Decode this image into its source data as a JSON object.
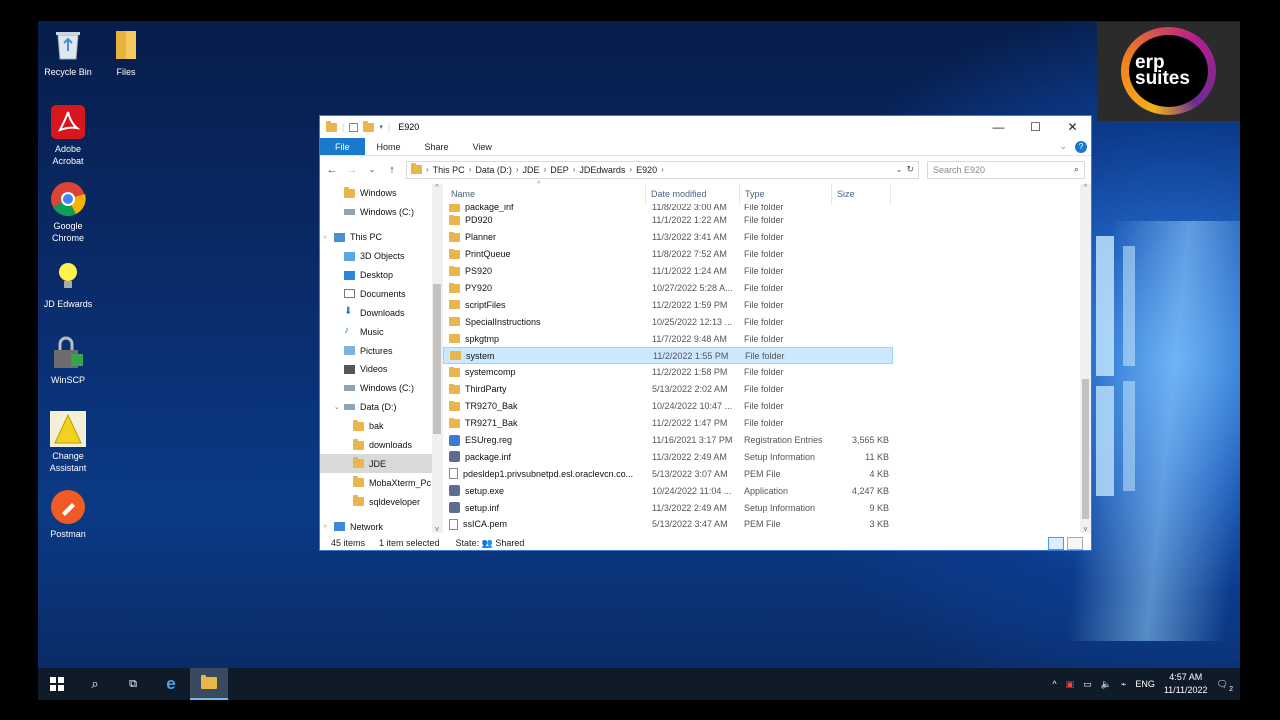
{
  "desktop_icons": [
    {
      "label": "Recycle Bin",
      "icon": "recycle-bin-icon"
    },
    {
      "label": "Files",
      "icon": "folder-icon"
    },
    {
      "label": "Adobe Acrobat",
      "icon": "acrobat-icon"
    },
    {
      "label": "Google Chrome",
      "icon": "chrome-icon"
    },
    {
      "label": "JD Edwards",
      "icon": "lightbulb-icon"
    },
    {
      "label": "WinSCP",
      "icon": "winscp-icon"
    },
    {
      "label": "Change Assistant",
      "icon": "change-assistant-icon"
    },
    {
      "label": "Postman",
      "icon": "postman-icon"
    }
  ],
  "brand": {
    "line1": "erp",
    "line2": "suites"
  },
  "window": {
    "title": "E920",
    "ribbon_tabs": [
      "File",
      "Home",
      "Share",
      "View"
    ],
    "breadcrumbs": [
      "This PC",
      "Data (D:)",
      "JDE",
      "DEP",
      "JDEdwards",
      "E920"
    ],
    "search_placeholder": "Search E920"
  },
  "nav_items": [
    {
      "label": "Windows",
      "icon": "folder",
      "indent": 1
    },
    {
      "label": "Windows (C:)",
      "icon": "drive",
      "indent": 1
    },
    {
      "label": "This PC",
      "icon": "pc",
      "indent": 0
    },
    {
      "label": "3D Objects",
      "icon": "3d",
      "indent": 1
    },
    {
      "label": "Desktop",
      "icon": "desktop",
      "indent": 1
    },
    {
      "label": "Documents",
      "icon": "documents",
      "indent": 1
    },
    {
      "label": "Downloads",
      "icon": "downloads",
      "indent": 1
    },
    {
      "label": "Music",
      "icon": "music",
      "indent": 1
    },
    {
      "label": "Pictures",
      "icon": "pictures",
      "indent": 1
    },
    {
      "label": "Videos",
      "icon": "videos",
      "indent": 1
    },
    {
      "label": "Windows (C:)",
      "icon": "drive",
      "indent": 1
    },
    {
      "label": "Data (D:)",
      "icon": "drive",
      "indent": 1
    },
    {
      "label": "bak",
      "icon": "folder",
      "indent": 2
    },
    {
      "label": "downloads",
      "icon": "folder",
      "indent": 2
    },
    {
      "label": "JDE",
      "icon": "folder",
      "indent": 2,
      "selected": true
    },
    {
      "label": "MobaXterm_Pc",
      "icon": "folder",
      "indent": 2
    },
    {
      "label": "sqldeveloper",
      "icon": "folder",
      "indent": 2
    },
    {
      "label": "Network",
      "icon": "network",
      "indent": 0
    }
  ],
  "columns": {
    "name": "Name",
    "date": "Date modified",
    "type": "Type",
    "size": "Size"
  },
  "files": [
    {
      "name": "package_inf",
      "date": "11/8/2022 3:00 AM",
      "type": "File folder",
      "size": "",
      "icon": "folder",
      "partial": true
    },
    {
      "name": "PD920",
      "date": "11/1/2022 1:22 AM",
      "type": "File folder",
      "size": "",
      "icon": "folder"
    },
    {
      "name": "Planner",
      "date": "11/3/2022 3:41 AM",
      "type": "File folder",
      "size": "",
      "icon": "folder"
    },
    {
      "name": "PrintQueue",
      "date": "11/8/2022 7:52 AM",
      "type": "File folder",
      "size": "",
      "icon": "folder"
    },
    {
      "name": "PS920",
      "date": "11/1/2022 1:24 AM",
      "type": "File folder",
      "size": "",
      "icon": "folder"
    },
    {
      "name": "PY920",
      "date": "10/27/2022 5:28 A...",
      "type": "File folder",
      "size": "",
      "icon": "folder"
    },
    {
      "name": "scriptFiles",
      "date": "11/2/2022 1:59 PM",
      "type": "File folder",
      "size": "",
      "icon": "folder"
    },
    {
      "name": "SpecialInstructions",
      "date": "10/25/2022 12:13 ...",
      "type": "File folder",
      "size": "",
      "icon": "folder"
    },
    {
      "name": "spkgtmp",
      "date": "11/7/2022 9:48 AM",
      "type": "File folder",
      "size": "",
      "icon": "folder"
    },
    {
      "name": "system",
      "date": "11/2/2022 1:55 PM",
      "type": "File folder",
      "size": "",
      "icon": "folder",
      "selected": true
    },
    {
      "name": "systemcomp",
      "date": "11/2/2022 1:58 PM",
      "type": "File folder",
      "size": "",
      "icon": "folder"
    },
    {
      "name": "ThirdParty",
      "date": "5/13/2022 2:02 AM",
      "type": "File folder",
      "size": "",
      "icon": "folder"
    },
    {
      "name": "TR9270_Bak",
      "date": "10/24/2022 10:47 ...",
      "type": "File folder",
      "size": "",
      "icon": "folder"
    },
    {
      "name": "TR9271_Bak",
      "date": "11/2/2022 1:47 PM",
      "type": "File folder",
      "size": "",
      "icon": "folder"
    },
    {
      "name": "ESUreg.reg",
      "date": "11/16/2021 3:17 PM",
      "type": "Registration Entries",
      "size": "3,565 KB",
      "icon": "reg"
    },
    {
      "name": "package.inf",
      "date": "11/3/2022 2:49 AM",
      "type": "Setup Information",
      "size": "11 KB",
      "icon": "gear"
    },
    {
      "name": "pdesldep1.privsubnetpd.esl.oraclevcn.co...",
      "date": "5/13/2022 3:07 AM",
      "type": "PEM File",
      "size": "4 KB",
      "icon": "file"
    },
    {
      "name": "setup.exe",
      "date": "10/24/2022 11:04 ...",
      "type": "Application",
      "size": "4,247 KB",
      "icon": "gear"
    },
    {
      "name": "setup.inf",
      "date": "11/3/2022 2:49 AM",
      "type": "Setup Information",
      "size": "9 KB",
      "icon": "gear"
    },
    {
      "name": "ssICA.pem",
      "date": "5/13/2022 3:47 AM",
      "type": "PEM File",
      "size": "3 KB",
      "icon": "file"
    }
  ],
  "status": {
    "count": "45 items",
    "selected": "1 item selected",
    "state_label": "State:",
    "state_value": "Shared"
  },
  "taskbar": {
    "lang": "ENG",
    "time": "4:57 AM",
    "date": "11/11/2022",
    "notifications": "2"
  }
}
